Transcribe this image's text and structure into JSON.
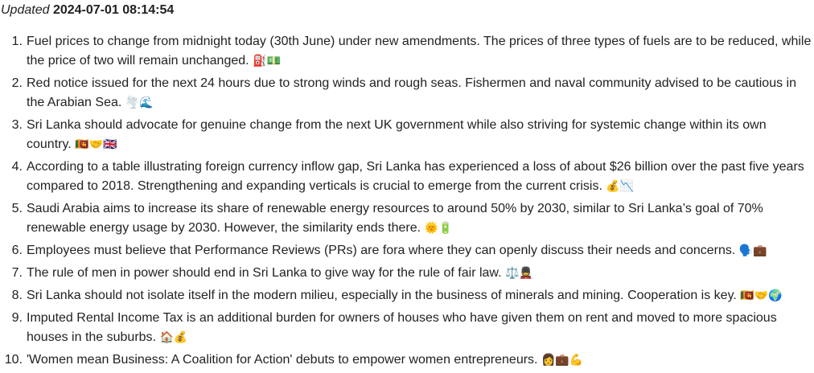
{
  "header": {
    "updated_label": "Updated",
    "timestamp": "2024-07-01 08:14:54"
  },
  "news": [
    {
      "number": "1.",
      "text": "Fuel prices to change from midnight today (30th June) under new amendments. The prices of three types of fuels are to be reduced, while the price of two will remain unchanged.",
      "emoji": "⛽💵"
    },
    {
      "number": "2.",
      "text": "Red notice issued for the next 24 hours due to strong winds and rough seas. Fishermen and naval community advised to be cautious in the Arabian Sea.",
      "emoji": "🌪️🌊"
    },
    {
      "number": "3.",
      "text": "Sri Lanka should advocate for genuine change from the next UK government while also striving for systemic change within its own country.",
      "emoji": "🇱🇰🤝🇬🇧"
    },
    {
      "number": "4.",
      "text": "According to a table illustrating foreign currency inflow gap, Sri Lanka has experienced a loss of about $26 billion over the past five years compared to 2018. Strengthening and expanding verticals is crucial to emerge from the current crisis.",
      "emoji": "💰📉"
    },
    {
      "number": "5.",
      "text": "Saudi Arabia aims to increase its share of renewable energy resources to around 50% by 2030, similar to Sri Lanka’s goal of 70% renewable energy usage by 2030. However, the similarity ends there.",
      "emoji": "🌞🔋"
    },
    {
      "number": "6.",
      "text": "Employees must believe that Performance Reviews (PRs) are fora where they can openly discuss their needs and concerns.",
      "emoji": "🗣️💼"
    },
    {
      "number": "7.",
      "text": "The rule of men in power should end in Sri Lanka to give way for the rule of fair law.",
      "emoji": "⚖️💂"
    },
    {
      "number": "8.",
      "text": "Sri Lanka should not isolate itself in the modern milieu, especially in the business of minerals and mining. Cooperation is key.",
      "emoji": "🇱🇰🤝🌍"
    },
    {
      "number": "9.",
      "text": "Imputed Rental Income Tax is an additional burden for owners of houses who have given them on rent and moved to more spacious houses in the suburbs.",
      "emoji": "🏠💰"
    },
    {
      "number": "10.",
      "text": "'Women mean Business: A Coalition for Action' debuts to empower women entrepreneurs.",
      "emoji": "👩💼💪"
    }
  ]
}
